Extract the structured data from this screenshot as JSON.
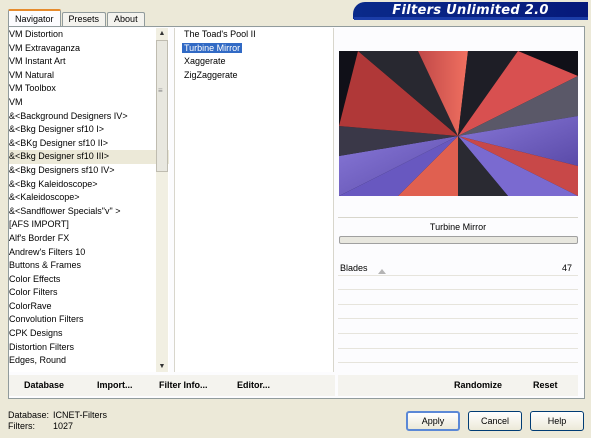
{
  "tabs": [
    "Navigator",
    "Presets",
    "About"
  ],
  "banner_title": "Filters Unlimited 2.0",
  "categories": [
    "VM Distortion",
    "VM Extravaganza",
    "VM Instant Art",
    "VM Natural",
    "VM Toolbox",
    "VM",
    "&<Background Designers IV>",
    "&<Bkg Designer sf10 I>",
    "&<BKg Designer sf10 II>",
    "&<Bkg Designer sf10 III>",
    "&<Bkg Designers sf10 IV>",
    "&<Bkg Kaleidoscope>",
    "&<Kaleidoscope>",
    "&<Sandflower Specials\"v\" >",
    "[AFS IMPORT]",
    "Alf's Border FX",
    "Andrew's Filters 10",
    "Buttons & Frames",
    "Color Effects",
    "Color Filters",
    "ColorRave",
    "Convolution Filters",
    "CPK Designs",
    "Distortion Filters",
    "Edges, Round"
  ],
  "highlighted_category_index": 9,
  "filters": [
    "The Toad's Pool II",
    "Turbine Mirror",
    "Xaggerate",
    "ZigZaggerate"
  ],
  "selected_filter_index": 1,
  "filter_name": "Turbine Mirror",
  "param": {
    "label": "Blades",
    "value": "47"
  },
  "bottom_left_buttons": [
    "Database",
    "Import...",
    "Filter Info...",
    "Editor..."
  ],
  "bottom_right_buttons": [
    "Randomize",
    "Reset"
  ],
  "info": {
    "database_label": "Database:",
    "database_value": "ICNET-Filters",
    "filters_label": "Filters:",
    "filters_value": "1027"
  },
  "dialog_buttons": {
    "apply": "Apply",
    "cancel": "Cancel",
    "help": "Help"
  },
  "colors": {
    "banner": "#0a2a8a",
    "selection": "#316ac5",
    "tab_accent": "#e68b2c"
  }
}
